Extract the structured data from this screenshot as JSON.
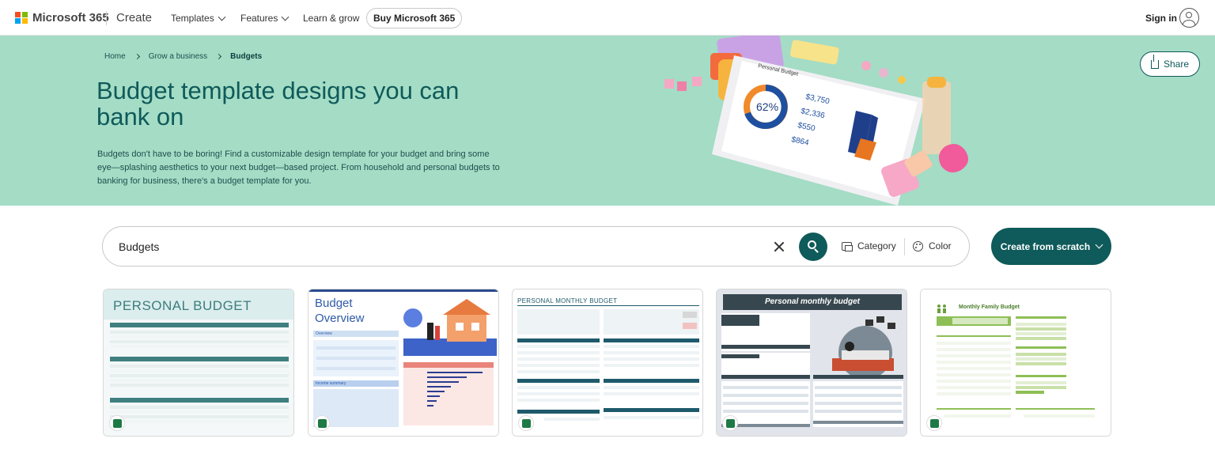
{
  "nav": {
    "brand": "Microsoft 365",
    "create": "Create",
    "templates": "Templates",
    "features": "Features",
    "learn": "Learn & grow",
    "buy": "Buy Microsoft 365",
    "signin": "Sign in"
  },
  "breadcrumb": {
    "home": "Home",
    "grow": "Grow a business",
    "current": "Budgets"
  },
  "hero": {
    "title": "Budget template designs you can bank on",
    "description": "Budgets don't have to be boring! Find a customizable design template for your budget and bring some eye—splashing aesthetics to your next budget—based project. From household and personal budgets to banking for business, there's a budget template for you.",
    "share": "Share",
    "art_title": "Personal Budget",
    "art_percent": "62%",
    "art_values": [
      "$3,750",
      "$2,336",
      "$550",
      "$864"
    ]
  },
  "search": {
    "value": "Budgets",
    "category": "Category",
    "color": "Color",
    "create": "Create from scratch"
  },
  "cards": [
    {
      "title": "PERSONAL BUDGET"
    },
    {
      "title": "Budget Overview",
      "line1": "Budget",
      "line2": "Overview",
      "sub": "Overview",
      "sub2": "Income summary"
    },
    {
      "title": "PERSONAL MONTHLY BUDGET"
    },
    {
      "title": "Personal monthly budget"
    },
    {
      "title": "Monthly Family Budget"
    }
  ],
  "colors": {
    "accent": "#0f5a5a",
    "hero_bg": "#a4dcc5"
  }
}
